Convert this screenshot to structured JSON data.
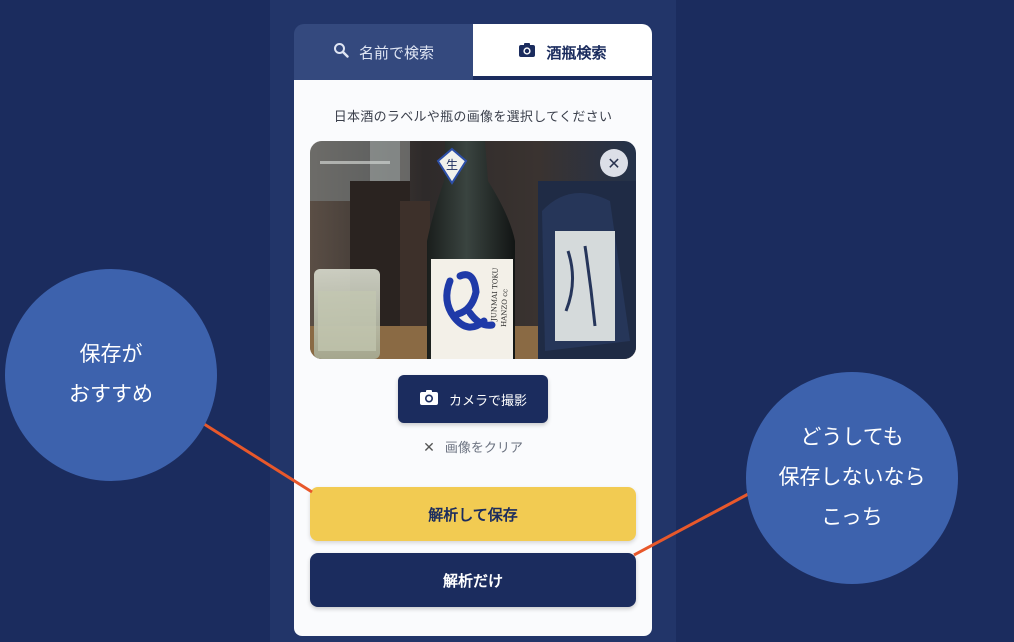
{
  "tabs": {
    "name_search": {
      "label": "名前で検索",
      "icon": "search-icon"
    },
    "bottle_search": {
      "label": "酒瓶検索",
      "icon": "camera-icon",
      "active": true
    }
  },
  "panel": {
    "instruction": "日本酒のラベルや瓶の画像を選択してください",
    "camera_button": "カメラで撮影",
    "clear_link": "画像をクリア",
    "save_button": "解析して保存",
    "analyze_button": "解析だけ"
  },
  "photo": {
    "cap_label": "生",
    "label_text_1": "JUNMAI TOKU",
    "label_text_2": "HANZO cc"
  },
  "callouts": {
    "left": [
      "保存が",
      "おすすめ"
    ],
    "right": [
      "どうしても",
      "保存しないなら",
      "こっち"
    ]
  },
  "colors": {
    "background": "#1b2c5e",
    "accent_yellow": "#f2cb52",
    "bubble": "#3d62ad",
    "connector": "#e8582b"
  }
}
